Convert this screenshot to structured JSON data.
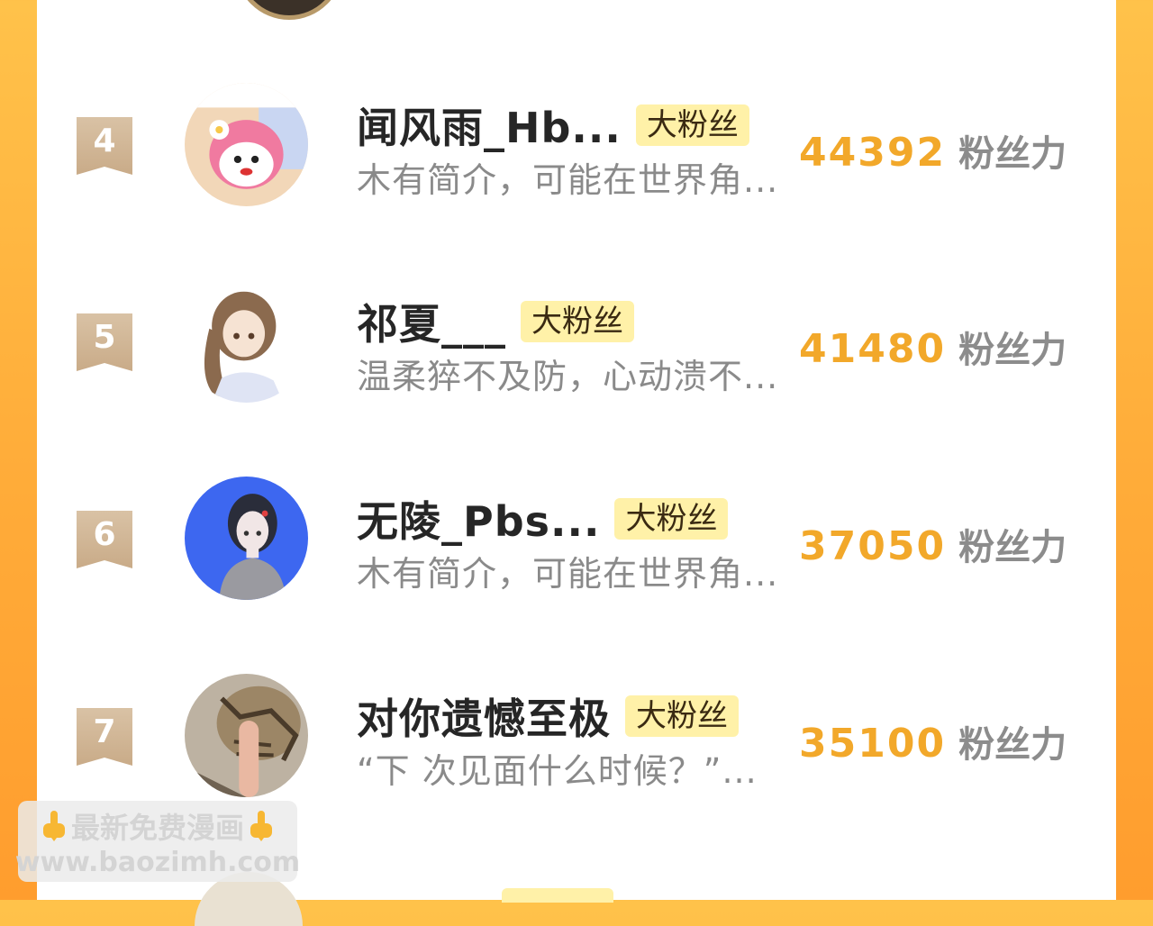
{
  "rows": [
    {
      "rank": "4",
      "name": "闻风雨_Hb...",
      "badge": "大粉丝",
      "desc": "木有简介，可能在世界角...",
      "power": "44392",
      "unit": "粉丝力",
      "avatar_icon": "pink-bunny-avatar"
    },
    {
      "rank": "5",
      "name": "祁夏___",
      "badge": "大粉丝",
      "desc": "温柔猝不及防，心动溃不...",
      "power": "41480",
      "unit": "粉丝力",
      "avatar_icon": "anime-girl-avatar"
    },
    {
      "rank": "6",
      "name": "无陵_Pbs...",
      "badge": "大粉丝",
      "desc": "木有简介，可能在世界角...",
      "power": "37050",
      "unit": "粉丝力",
      "avatar_icon": "anime-boy-blue-avatar"
    },
    {
      "rank": "7",
      "name": "对你遗憾至极",
      "badge": "大粉丝",
      "desc": "“下  次见面什么时候？”...",
      "power": "35100",
      "unit": "粉丝力",
      "avatar_icon": "cat-finger-avatar"
    }
  ],
  "watermark": {
    "line1": "最新免费漫画",
    "line2": "www.baozimh.com"
  },
  "colors": {
    "accent": "#f2a82a",
    "badge_bg": "#fff1a8",
    "rank_bg": "#d2b896",
    "frame": "#ffad3a"
  }
}
